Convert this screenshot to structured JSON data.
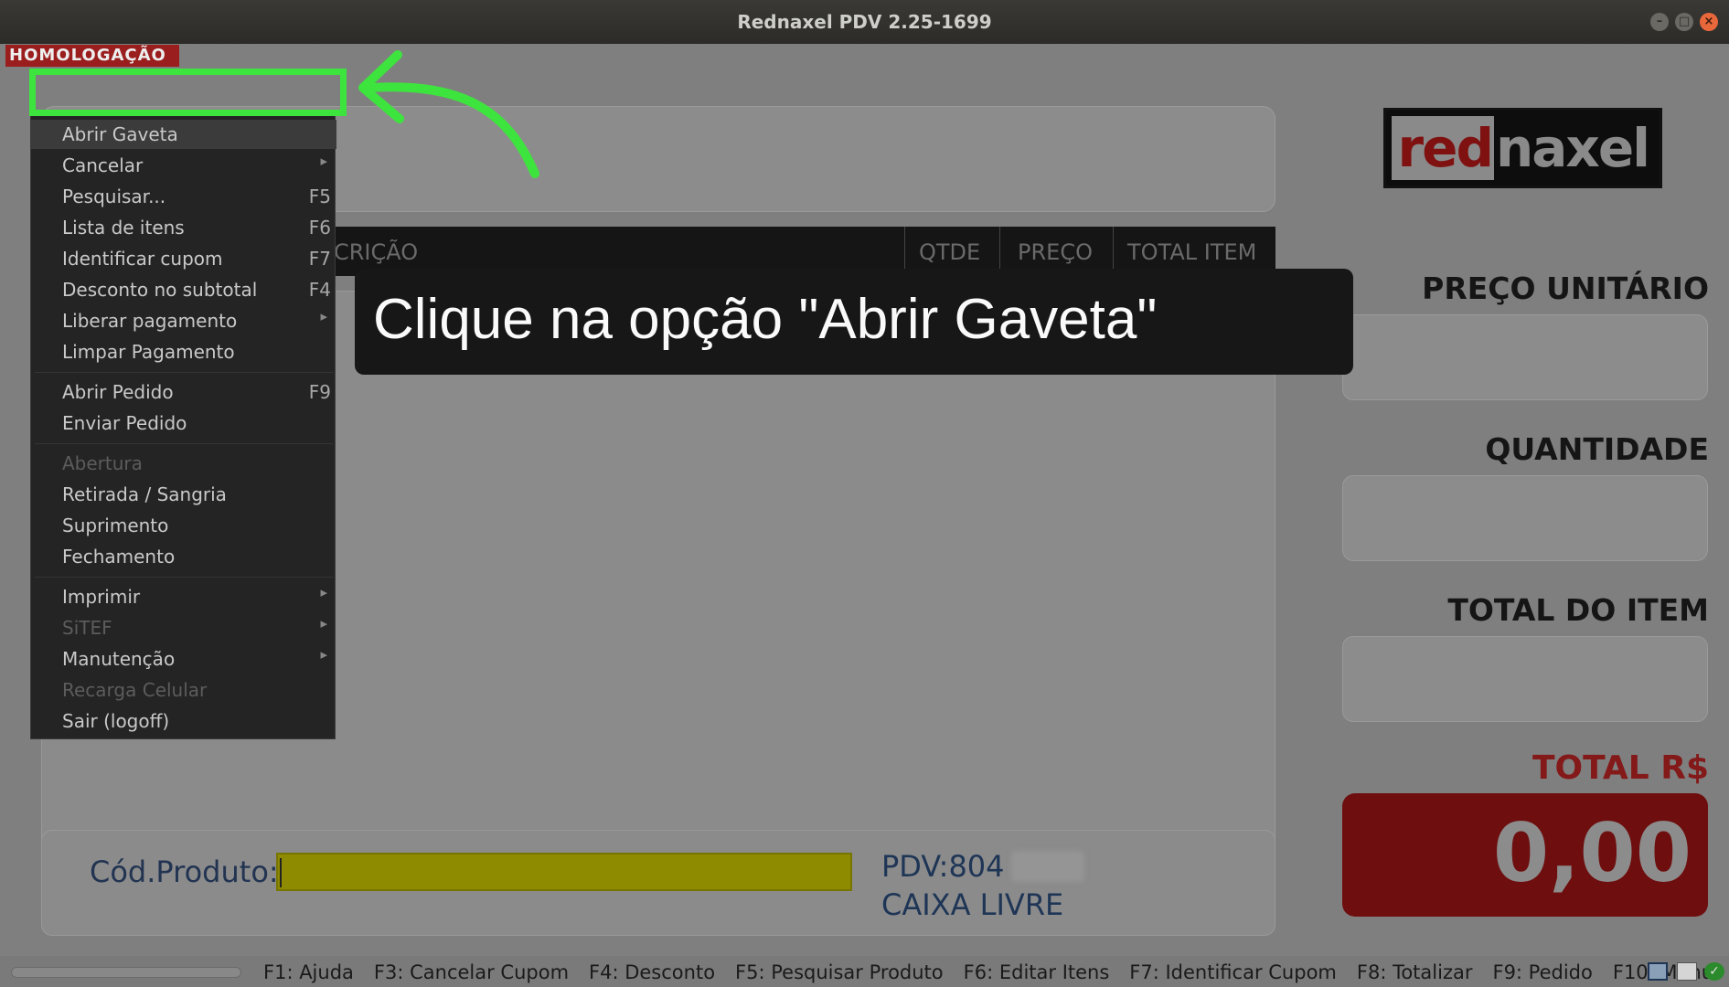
{
  "window": {
    "title": "Rednaxel PDV 2.25-1699",
    "buttons": [
      "minimize",
      "maximize",
      "close"
    ]
  },
  "environment_badge": "HOMOLOGAÇÃO",
  "table_header": {
    "columns": [
      "CRIÇÃO",
      "QTDE",
      "PREÇO",
      "TOTAL ITEM"
    ]
  },
  "logo": {
    "part1": "red",
    "part2": "naxel"
  },
  "side": {
    "unit_price_label": "PREÇO UNITÁRIO",
    "quantity_label": "QUANTIDADE",
    "item_total_label": "TOTAL DO ITEM",
    "total_label": "TOTAL R$",
    "total_value": "0,00"
  },
  "input": {
    "product_code_label": "Cód.Produto:",
    "product_code_value": "",
    "pdv": "PDV:804",
    "status": "CAIXA LIVRE"
  },
  "menu": {
    "items": [
      {
        "label": "Abrir Gaveta",
        "shortcut": "",
        "submenu": false,
        "enabled": true
      },
      {
        "label": "Cancelar",
        "shortcut": "",
        "submenu": true,
        "enabled": true
      },
      {
        "label": "Pesquisar...",
        "shortcut": "F5",
        "submenu": false,
        "enabled": true
      },
      {
        "label": "Lista de itens",
        "shortcut": "F6",
        "submenu": false,
        "enabled": true
      },
      {
        "label": "Identificar cupom",
        "shortcut": "F7",
        "submenu": false,
        "enabled": true
      },
      {
        "label": "Desconto no subtotal",
        "shortcut": "F4",
        "submenu": false,
        "enabled": true
      },
      {
        "label": "Liberar pagamento",
        "shortcut": "",
        "submenu": true,
        "enabled": true
      },
      {
        "label": "Limpar Pagamento",
        "shortcut": "",
        "submenu": false,
        "enabled": true
      },
      {
        "label": "Abrir Pedido",
        "shortcut": "F9",
        "submenu": false,
        "enabled": true
      },
      {
        "label": "Enviar Pedido",
        "shortcut": "",
        "submenu": false,
        "enabled": true
      },
      {
        "label": "Abertura",
        "shortcut": "",
        "submenu": false,
        "enabled": false
      },
      {
        "label": "Retirada / Sangria",
        "shortcut": "",
        "submenu": false,
        "enabled": true
      },
      {
        "label": "Suprimento",
        "shortcut": "",
        "submenu": false,
        "enabled": true
      },
      {
        "label": "Fechamento",
        "shortcut": "",
        "submenu": false,
        "enabled": true
      },
      {
        "label": "Imprimir",
        "shortcut": "",
        "submenu": true,
        "enabled": true
      },
      {
        "label": "SiTEF",
        "shortcut": "",
        "submenu": true,
        "enabled": false
      },
      {
        "label": "Manutenção",
        "shortcut": "",
        "submenu": true,
        "enabled": true
      },
      {
        "label": "Recarga Celular",
        "shortcut": "",
        "submenu": false,
        "enabled": false
      },
      {
        "label": "Sair (logoff)",
        "shortcut": "",
        "submenu": false,
        "enabled": true
      }
    ]
  },
  "callout": {
    "text": "Clique na opção \"Abrir Gaveta\""
  },
  "statusbar": {
    "shortcuts": [
      "F1: Ajuda",
      "F3: Cancelar Cupom",
      "F4: Desconto",
      "F5: Pesquisar Produto",
      "F6: Editar Itens",
      "F7: Identificar Cupom",
      "F8: Totalizar",
      "F9: Pedido",
      "F10: Menu"
    ]
  },
  "colors": {
    "highlight": "#3ee43e",
    "total_box": "#6e0e0e",
    "homolog_badge": "#9a1e1e",
    "input_bg": "#8f8b00"
  }
}
